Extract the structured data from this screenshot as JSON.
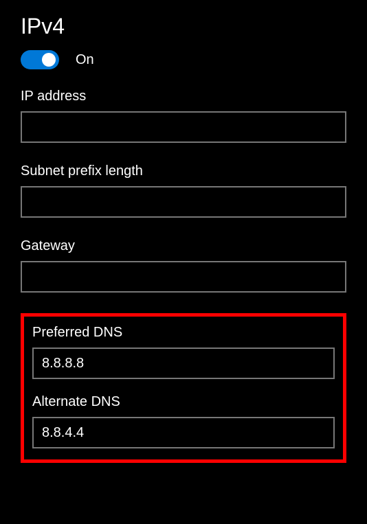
{
  "title": "IPv4",
  "toggle": {
    "state": "On",
    "accent": "#0078d7"
  },
  "fields": {
    "ip_address": {
      "label": "IP address",
      "value": ""
    },
    "subnet": {
      "label": "Subnet prefix length",
      "value": ""
    },
    "gateway": {
      "label": "Gateway",
      "value": ""
    },
    "preferred_dns": {
      "label": "Preferred DNS",
      "value": "8.8.8.8"
    },
    "alternate_dns": {
      "label": "Alternate DNS",
      "value": "8.8.4.4"
    }
  }
}
